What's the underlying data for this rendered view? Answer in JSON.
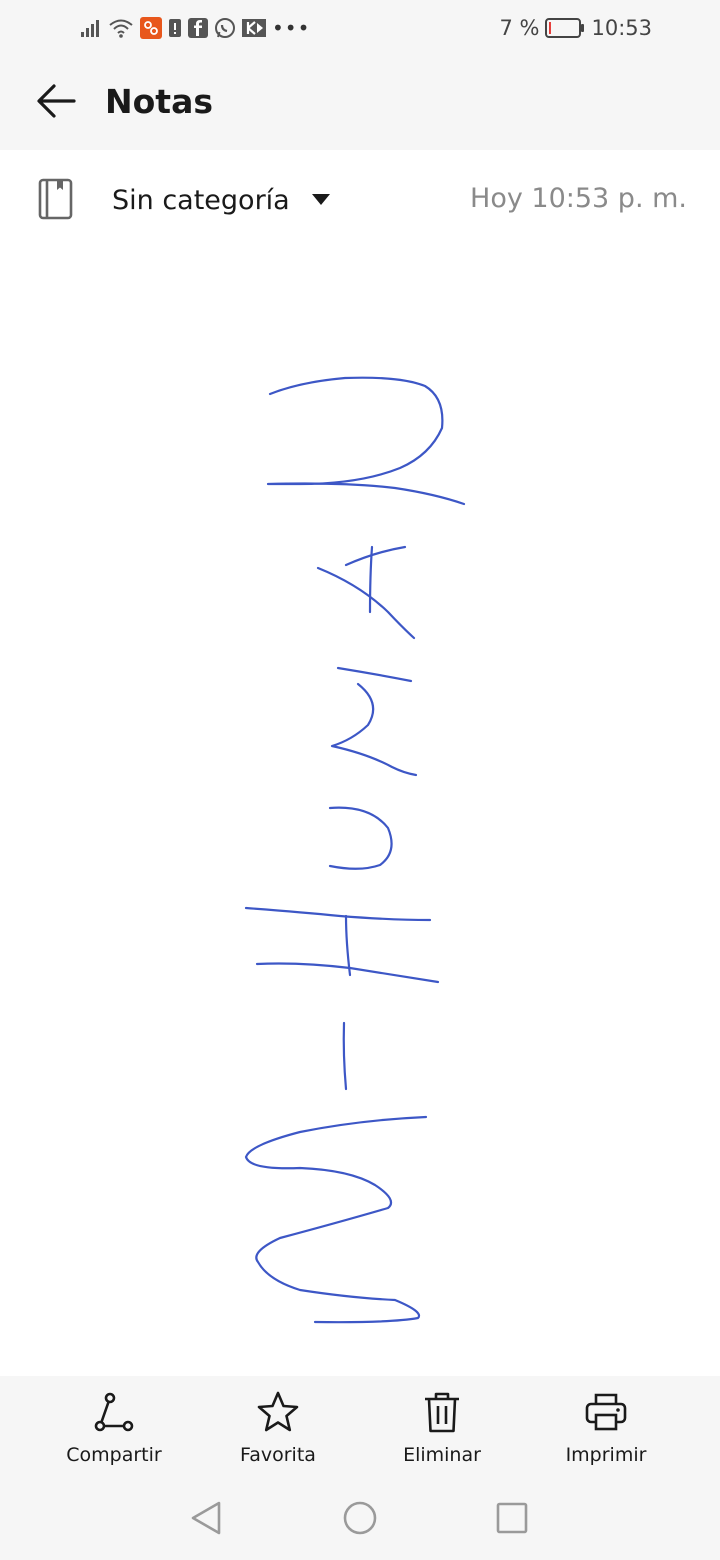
{
  "status_bar": {
    "battery_percent": "7 %",
    "time": "10:53",
    "battery_level": 0.07,
    "battery_low_color": "#e53935",
    "app_icon_color": "#e8571c"
  },
  "app_bar": {
    "back_icon": "arrow-left-icon",
    "title": "Notas"
  },
  "note_meta": {
    "notebook_icon": "notebook-icon",
    "category": "Sin categoría",
    "dropdown_icon": "caret-down-icon",
    "timestamp": "Hoy 10:53 p. m."
  },
  "ink": {
    "color": "#3d57c6"
  },
  "actions": [
    {
      "label": "Compartir",
      "icon": "share-icon"
    },
    {
      "label": "Favorita",
      "icon": "star-icon"
    },
    {
      "label": "Eliminar",
      "icon": "trash-icon"
    },
    {
      "label": "Imprimir",
      "icon": "printer-icon"
    }
  ],
  "nav": {
    "back_icon": "triangle-back-icon",
    "home_icon": "circle-home-icon",
    "recents_icon": "square-recents-icon"
  }
}
